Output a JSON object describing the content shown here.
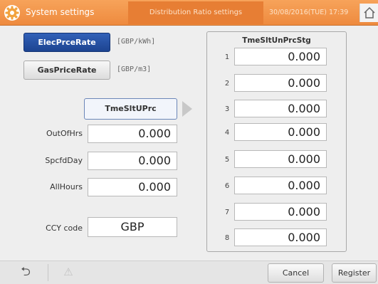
{
  "header": {
    "title": "System settings",
    "tab": "Distribution Ratio settings",
    "datetime": "30/08/2016(TUE) 17:39"
  },
  "rate_buttons": {
    "elec_label": "ElecPrceRate",
    "elec_unit": "[GBP/kWh]",
    "gas_label": "GasPriceRate",
    "gas_unit": "[GBP/m3]"
  },
  "left": {
    "tab_label": "TmeSltUPrc",
    "fields": [
      {
        "label": "OutOfHrs",
        "value": "0.000"
      },
      {
        "label": "SpcfdDay",
        "value": "0.000"
      },
      {
        "label": "AllHours",
        "value": "0.000"
      }
    ],
    "ccy_label": "CCY code",
    "ccy_value": "GBP"
  },
  "panel": {
    "title": "TmeSltUnPrcStg",
    "rows": [
      {
        "num": "1",
        "value": "0.000"
      },
      {
        "num": "2",
        "value": "0.000"
      },
      {
        "num": "3",
        "value": "0.000"
      },
      {
        "num": "4",
        "value": "0.000"
      },
      {
        "num": "5",
        "value": "0.000"
      },
      {
        "num": "6",
        "value": "0.000"
      },
      {
        "num": "7",
        "value": "0.000"
      },
      {
        "num": "8",
        "value": "0.000"
      }
    ]
  },
  "footer": {
    "back_glyph": "⮌",
    "warning_glyph": "⚠",
    "cancel_label": "Cancel",
    "register_label": "Register"
  },
  "colors": {
    "header_orange": "#f09143",
    "selected_blue": "#1f4897"
  },
  "icons": [
    "gear-icon",
    "home-icon",
    "back-icon",
    "warning-icon",
    "arrow-right-icon"
  ]
}
